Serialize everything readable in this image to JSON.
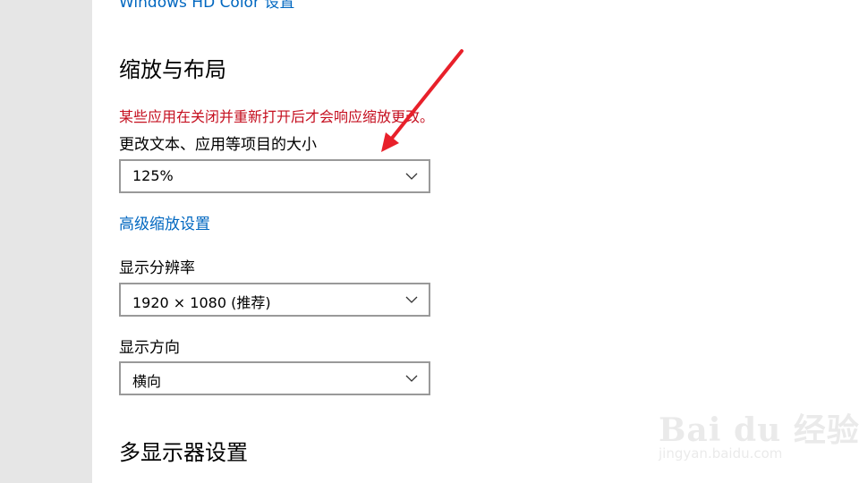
{
  "top_link": {
    "label": "Windows HD Color 设置"
  },
  "scale_layout": {
    "title": "缩放与布局",
    "warning": "某些应用在关闭并重新打开后才会响应缩放更改。",
    "size_label": "更改文本、应用等项目的大小",
    "size_value": "125%",
    "advanced_link": "高级缩放设置",
    "resolution_label": "显示分辨率",
    "resolution_value": "1920 × 1080 (推荐)",
    "orientation_label": "显示方向",
    "orientation_value": "横向"
  },
  "multi_display": {
    "title": "多显示器设置"
  },
  "annotation": {
    "arrow_color": "#e8202a"
  },
  "watermark": {
    "brand": "Bai du 经验",
    "url": "jingyan.baidu.com"
  },
  "colors": {
    "link": "#0067c0",
    "warning": "#c50f1f",
    "sidebar": "#e6e6e6",
    "dropdown_border": "#999999"
  }
}
